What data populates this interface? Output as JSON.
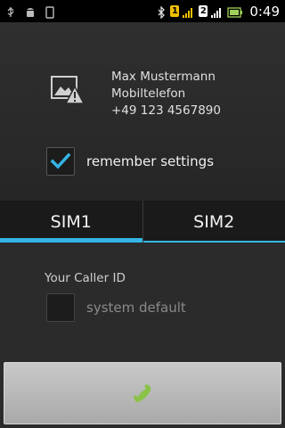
{
  "status_bar": {
    "time": "0:49",
    "icons": [
      "usb-icon",
      "android-debug-icon",
      "sd-card-icon",
      "bluetooth-icon",
      "sim1-signal-icon",
      "sim2-signal-icon",
      "battery-icon"
    ],
    "sim1_badge": "1",
    "sim2_badge": "2"
  },
  "contact": {
    "name": "Max Mustermann",
    "number_type": "Mobiltelefon",
    "number": "+49 123 4567890"
  },
  "remember": {
    "label": "remember settings",
    "checked": true
  },
  "tabs": [
    {
      "label": "SIM1",
      "active": true
    },
    {
      "label": "SIM2",
      "active": false
    }
  ],
  "caller_id": {
    "label": "Your Caller ID",
    "option_label": "system default",
    "checked": false
  },
  "colors": {
    "accent": "#34b5e5",
    "call_green": "#8bc34a"
  }
}
